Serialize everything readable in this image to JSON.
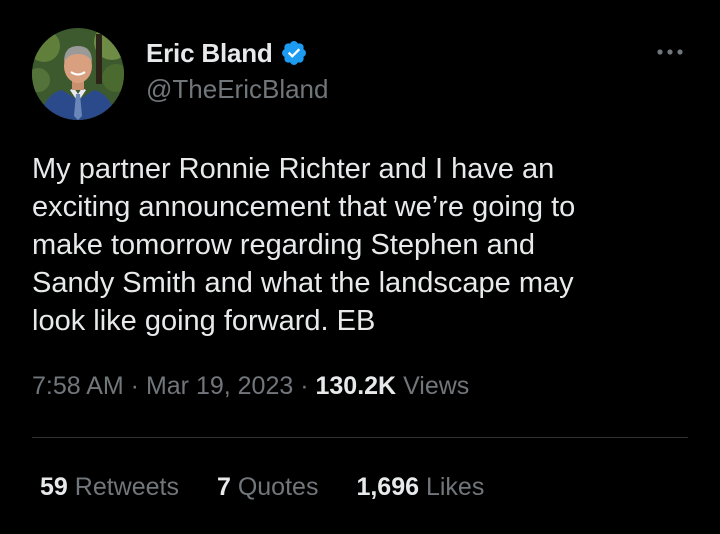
{
  "author": {
    "display_name": "Eric Bland",
    "handle": "@TheEricBland",
    "verified_icon": "verified-badge-icon",
    "verified_color": "#1d9bf0"
  },
  "tweet": {
    "text": "My partner Ronnie Richter and I have an\nexciting announcement that we’re going to\nmake tomorrow regarding Stephen and\nSandy Smith and what the landscape may\nlook like going forward. EB",
    "time": "7:58 AM",
    "separator": " · ",
    "date": "Mar 19, 2023",
    "views_count": "130.2K",
    "views_label": " Views"
  },
  "stats": {
    "retweets_count": "59",
    "retweets_label": " Retweets",
    "quotes_count": "7",
    "quotes_label": " Quotes",
    "likes_count": "1,696",
    "likes_label": " Likes"
  },
  "colors": {
    "background": "#000000",
    "primary_text": "#e7e9ea",
    "secondary_text": "#71767b",
    "divider": "#2f3336"
  }
}
